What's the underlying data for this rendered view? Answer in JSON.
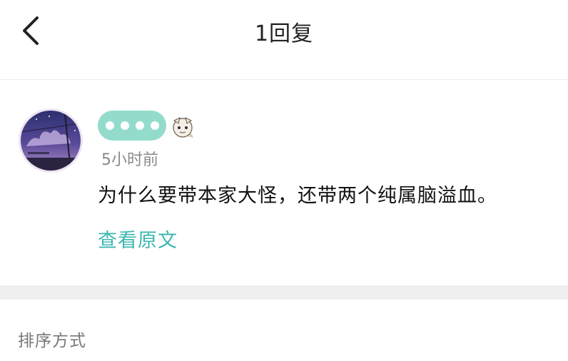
{
  "header": {
    "title": "1回复",
    "back_icon": "chevron-left-icon"
  },
  "comment": {
    "avatar_icon": "user-avatar",
    "username_badge_icon": "character-badge-icon",
    "timestamp": "5小时前",
    "text": "为什么要带本家大怪，还带两个纯属脑溢血。",
    "view_original_label": "查看原文"
  },
  "sort": {
    "label": "排序方式"
  },
  "colors": {
    "accent": "#3cb7b0",
    "username_pill": "#93dccc",
    "divider": "#efefef"
  }
}
